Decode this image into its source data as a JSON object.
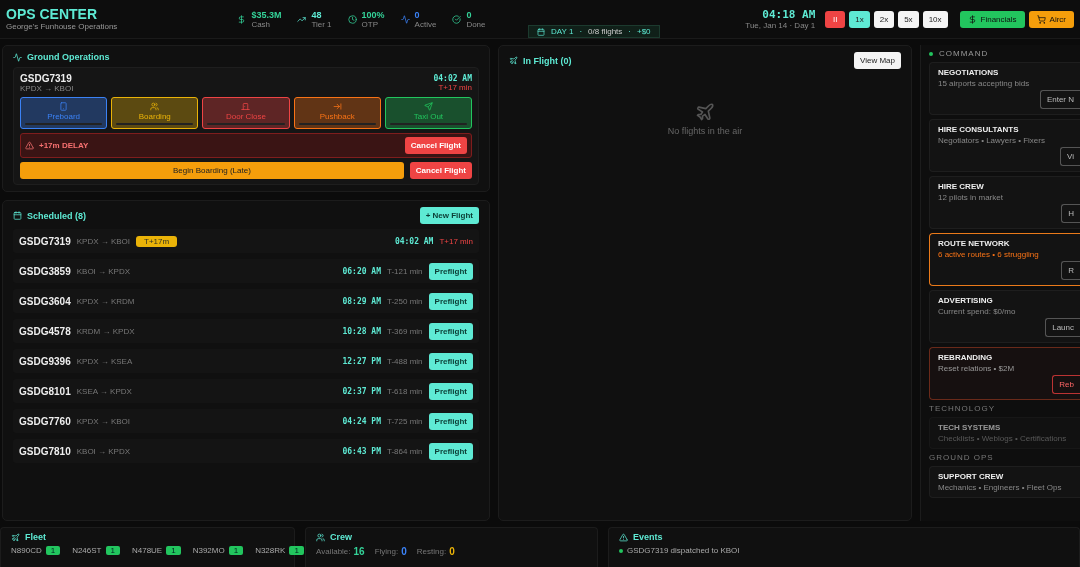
{
  "header": {
    "title": "OPS CENTER",
    "subtitle": "George's Funhouse Operations",
    "stats": [
      {
        "kind": "cash",
        "value": "$35.3M",
        "label": "Cash"
      },
      {
        "kind": "tier",
        "value": "48",
        "label": "Tier 1"
      },
      {
        "kind": "otp",
        "value": "100%",
        "label": "OTP"
      },
      {
        "kind": "active",
        "value": "0",
        "label": "Active"
      },
      {
        "kind": "done",
        "value": "0",
        "label": "Done"
      }
    ],
    "clock": "04:18 AM",
    "date": "Tue, Jan 14 · Day 1",
    "speeds": [
      {
        "kind": "pause",
        "label": "II",
        "selected": false
      },
      {
        "kind": "speed",
        "label": "1x",
        "selected": true
      },
      {
        "kind": "speed",
        "label": "2x",
        "selected": false
      },
      {
        "kind": "speed",
        "label": "5x",
        "selected": false
      },
      {
        "kind": "speed",
        "label": "10x",
        "selected": false
      }
    ],
    "actions": [
      {
        "kind": "financials",
        "label": "Financials"
      },
      {
        "kind": "aircraft",
        "label": "Aircr"
      }
    ]
  },
  "day_banner": {
    "day": "DAY 1",
    "separator": "·",
    "flights": "0/8 flights",
    "delta": "+$0"
  },
  "ground_ops": {
    "title": "Ground Operations",
    "flight": "GSDG7319",
    "route": "KPDX → KBOI",
    "time": "04:02 AM",
    "offset": "T+17 min",
    "phases": [
      {
        "kind": "preboard",
        "label": "Preboard",
        "color": "#3b82f6",
        "level": 0
      },
      {
        "kind": "boarding",
        "label": "Boarding",
        "color": "#eab308",
        "level": 0
      },
      {
        "kind": "door",
        "label": "Door Close",
        "color": "#ef4444",
        "level": 0
      },
      {
        "kind": "pushback",
        "label": "Pushback",
        "color": "#f97316",
        "level": 0
      },
      {
        "kind": "taxi",
        "label": "Taxi Out",
        "color": "#22c55e",
        "level": 0
      }
    ],
    "delay": {
      "text": "+17m DELAY",
      "button": "Cancel Flight"
    },
    "primary": "Begin Boarding (Late)",
    "cancel": "Cancel Flight"
  },
  "scheduled": {
    "title": "Scheduled (8)",
    "new_button": "+ New Flight",
    "rows": [
      {
        "flight": "GSDG7319",
        "route": "KPDX → KBOI",
        "badge": "T+17m",
        "time": "04:02 AM",
        "offset": "T+17 min",
        "late": true
      },
      {
        "flight": "GSDG3859",
        "route": "KBOI → KPDX",
        "time": "06:20 AM",
        "offset": "T-121 min",
        "late": false,
        "button": "Preflight"
      },
      {
        "flight": "GSDG3604",
        "route": "KPDX → KRDM",
        "time": "08:29 AM",
        "offset": "T-250 min",
        "late": false,
        "button": "Preflight"
      },
      {
        "flight": "GSDG4578",
        "route": "KRDM → KPDX",
        "time": "10:28 AM",
        "offset": "T-369 min",
        "late": false,
        "button": "Preflight"
      },
      {
        "flight": "GSDG9396",
        "route": "KPDX → KSEA",
        "time": "12:27 PM",
        "offset": "T-488 min",
        "late": false,
        "button": "Preflight"
      },
      {
        "flight": "GSDG8101",
        "route": "KSEA → KPDX",
        "time": "02:37 PM",
        "offset": "T-618 min",
        "late": false,
        "button": "Preflight"
      },
      {
        "flight": "GSDG7760",
        "route": "KPDX → KBOI",
        "time": "04:24 PM",
        "offset": "T-725 min",
        "late": false,
        "button": "Preflight"
      },
      {
        "flight": "GSDG7810",
        "route": "KBOI → KPDX",
        "time": "06:43 PM",
        "offset": "T-864 min",
        "late": false,
        "button": "Preflight"
      }
    ]
  },
  "in_flight": {
    "title": "In Flight (0)",
    "map_button": "View Map",
    "empty": "No flights in the air"
  },
  "command": {
    "title": "COMMAND",
    "cards": [
      {
        "title": "NEGOTIATIONS",
        "detail": "15 airports accepting bids",
        "button": "Enter N",
        "kind": "normal"
      },
      {
        "title": "HIRE CONSULTANTS",
        "detail": "Negotiators • Lawyers • Fixers",
        "button": "Vi",
        "kind": "normal"
      },
      {
        "title": "HIRE CREW",
        "detail": "12 pilots in market",
        "button": "H",
        "kind": "normal"
      },
      {
        "title": "ROUTE NETWORK",
        "detail": "6 active routes • 6 struggling",
        "button": "R",
        "kind": "warning"
      },
      {
        "title": "ADVERTISING",
        "detail": "Current spend: $0/mo",
        "button": "Launc",
        "kind": "normal"
      },
      {
        "title": "REBRANDING",
        "detail": "Reset relations • $2M",
        "button": "Reb",
        "kind": "danger"
      },
      {
        "section": "TECHNOLOGY"
      },
      {
        "title": "TECH SYSTEMS",
        "detail": "Checklists • Weblogs • Certifications",
        "kind": "disabled"
      },
      {
        "section": "GROUND OPS"
      },
      {
        "title": "SUPPORT CREW",
        "detail": "Mechanics • Engineers • Fleet Ops",
        "kind": "normal"
      }
    ]
  },
  "fleet": {
    "title": "Fleet",
    "aircraft": [
      {
        "tail": "N890CD",
        "badge": "1"
      },
      {
        "tail": "N246ST",
        "badge": "1"
      },
      {
        "tail": "N478UE",
        "badge": "1"
      },
      {
        "tail": "N392MO",
        "badge": "1"
      },
      {
        "tail": "N328RK",
        "badge": "1"
      }
    ]
  },
  "crew": {
    "title": "Crew",
    "stats": [
      {
        "label": "Available:",
        "value": "16",
        "color": "#34d399"
      },
      {
        "label": "Flying:",
        "value": "0",
        "color": "#3b82f6"
      },
      {
        "label": "Resting:",
        "value": "0",
        "color": "#eab308"
      }
    ]
  },
  "events": {
    "title": "Events",
    "items": [
      "GSDG7319 dispatched to KBOI"
    ]
  }
}
